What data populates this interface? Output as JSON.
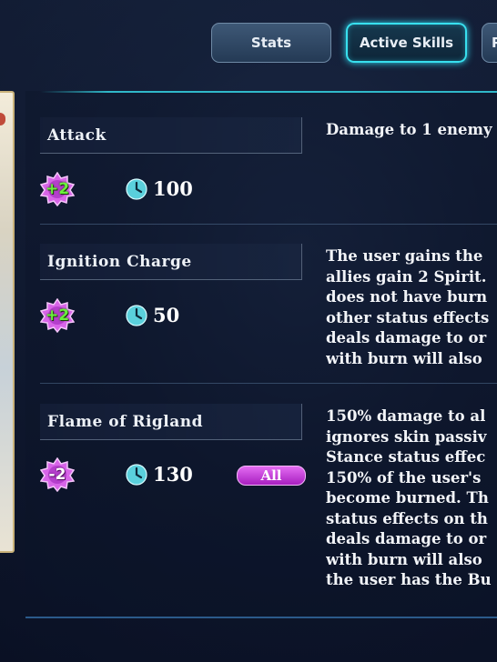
{
  "tabs": [
    {
      "label": "Stats",
      "active": false
    },
    {
      "label": "Active Skills",
      "active": true
    },
    {
      "label": "P",
      "active": false
    }
  ],
  "skills": [
    {
      "name": "Attack",
      "spirit": "+2",
      "spirit_type": "gain",
      "cooldown": "100",
      "target": "",
      "description": "Damage to 1 enemy"
    },
    {
      "name": "Ignition Charge",
      "spirit": "+2",
      "spirit_type": "gain",
      "cooldown": "50",
      "target": "",
      "description": "The user gains the\nallies gain 2 Spirit.\ndoes not have burn\nother status effects\ndeals damage to or\nwith burn will also"
    },
    {
      "name": "Flame of Rigland",
      "spirit": "-2",
      "spirit_type": "cost",
      "cooldown": "130",
      "target": "All",
      "description": "150% damage to al\nignores skin passiv\nStance status effec\n150% of the user's\nbecome burned. Th\nstatus effects on th\ndeals damage to or\nwith burn will also\nthe user has the Bu"
    }
  ],
  "icons": {
    "spirit_gain": "spirit-gain-icon",
    "spirit_cost": "spirit-cost-icon",
    "cooldown": "clock-icon"
  },
  "colors": {
    "accent": "#38e0ef",
    "spirit_gain": "#6bf03c",
    "spirit_badge": "#d864e8",
    "target_pill": "#c23fd8",
    "clock": "#5ad0dc"
  }
}
